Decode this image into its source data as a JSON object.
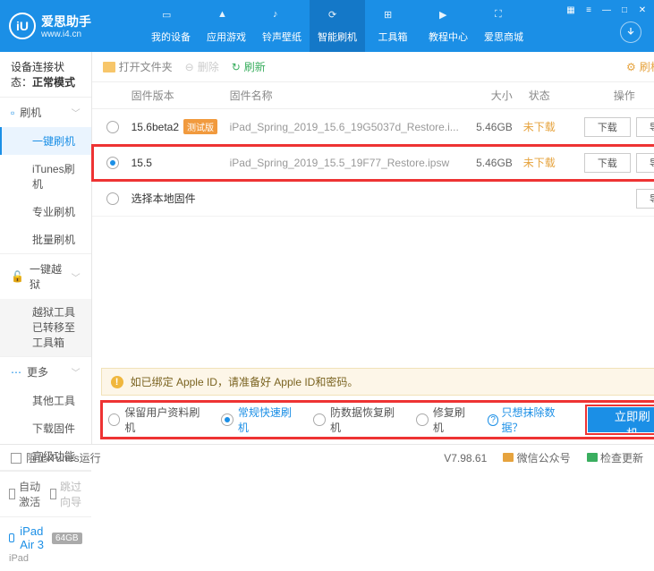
{
  "app": {
    "name": "爱思助手",
    "url": "www.i4.cn"
  },
  "nav": {
    "items": [
      {
        "label": "我的设备"
      },
      {
        "label": "应用游戏"
      },
      {
        "label": "铃声壁纸"
      },
      {
        "label": "智能刷机"
      },
      {
        "label": "工具箱"
      },
      {
        "label": "教程中心"
      },
      {
        "label": "爱思商城"
      }
    ],
    "active_index": 3
  },
  "conn_status": {
    "prefix": "设备连接状态：",
    "value": "正常模式"
  },
  "sidebar": {
    "groups": [
      {
        "title": "刷机",
        "items": [
          "一键刷机",
          "iTunes刷机",
          "专业刷机",
          "批量刷机"
        ],
        "selected": 0
      },
      {
        "title": "一键越狱",
        "items": [
          "越狱工具已转移至工具箱"
        ]
      },
      {
        "title": "更多",
        "items": [
          "其他工具",
          "下载固件",
          "高级功能"
        ]
      }
    ],
    "bottom": {
      "auto_activate": "自动激活",
      "skip_guide": "跳过向导"
    },
    "device": {
      "name": "iPad Air 3",
      "storage": "64GB",
      "type": "iPad"
    }
  },
  "toolbar": {
    "open": "打开文件夹",
    "delete": "删除",
    "refresh": "刷新",
    "settings": "刷机设置"
  },
  "columns": {
    "ver": "固件版本",
    "name": "固件名称",
    "size": "大小",
    "status": "状态",
    "ops": "操作"
  },
  "firmware": [
    {
      "ver": "15.6beta2",
      "beta": "测试版",
      "name": "iPad_Spring_2019_15.6_19G5037d_Restore.i...",
      "size": "5.46GB",
      "status": "未下载",
      "selected": false
    },
    {
      "ver": "15.5",
      "beta": "",
      "name": "iPad_Spring_2019_15.5_19F77_Restore.ipsw",
      "size": "5.46GB",
      "status": "未下载",
      "selected": true
    }
  ],
  "local_fw": "选择本地固件",
  "btns": {
    "download": "下载",
    "import": "导入"
  },
  "notice": "如已绑定 Apple ID，请准备好 Apple ID和密码。",
  "modes": {
    "keep": "保留用户资料刷机",
    "normal": "常规快速刷机",
    "recover": "防数据恢复刷机",
    "repair": "修复刷机",
    "clear_link": "只想抹除数据？",
    "primary": "立即刷机",
    "selected": 1
  },
  "footer": {
    "block": "阻止iTunes运行",
    "ver": "V7.98.61",
    "wechat": "微信公众号",
    "update": "检查更新"
  }
}
